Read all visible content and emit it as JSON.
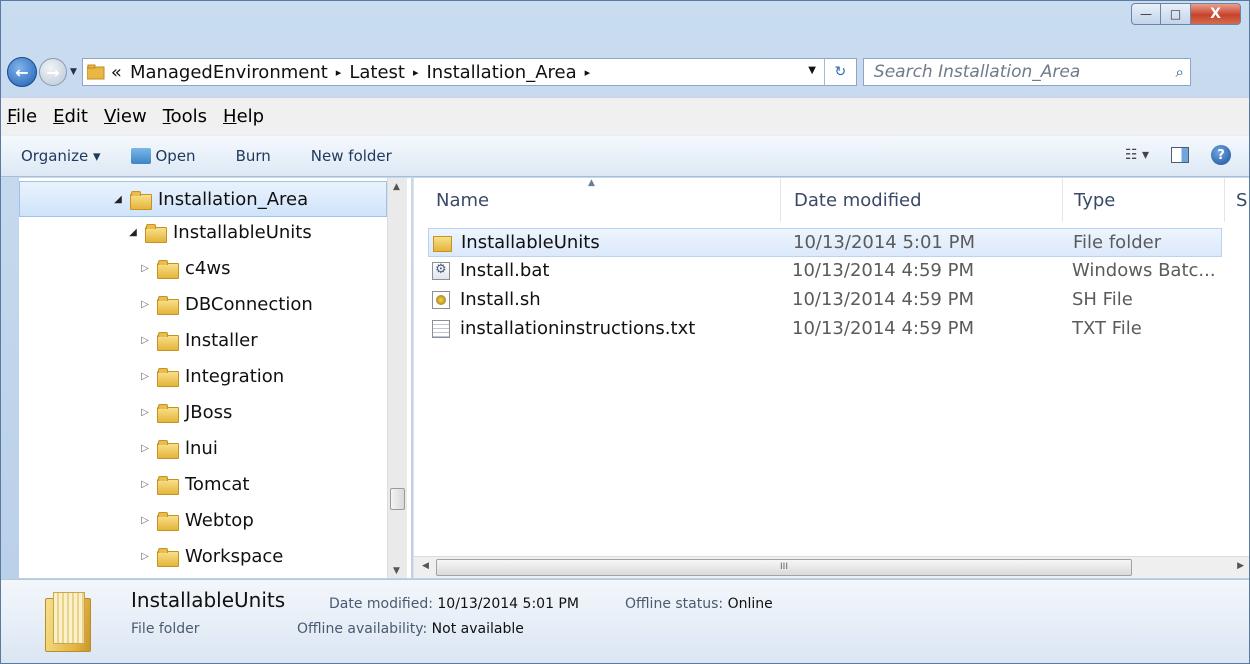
{
  "window": {
    "caption_buttons": {
      "minimize": "—",
      "maximize": "□",
      "close": "X"
    }
  },
  "navigation": {
    "back_icon": "back-arrow-icon",
    "forward_icon": "forward-arrow-icon",
    "breadcrumb": {
      "overflow": "«",
      "items": [
        "ManagedEnvironment",
        "Latest",
        "Installation_Area"
      ],
      "separator": "▸"
    },
    "search_placeholder": "Search Installation_Area"
  },
  "menu": [
    "File",
    "Edit",
    "View",
    "Tools",
    "Help"
  ],
  "commands": {
    "organize": "Organize ▾",
    "open": "Open",
    "burn": "Burn",
    "new_folder": "New folder"
  },
  "tree": [
    {
      "label": "Installation_Area",
      "state": "expanded",
      "selected": true
    },
    {
      "label": "InstallableUnits",
      "state": "expanded"
    },
    {
      "label": "c4ws",
      "state": "collapsed"
    },
    {
      "label": "DBConnection",
      "state": "collapsed"
    },
    {
      "label": "Installer",
      "state": "collapsed"
    },
    {
      "label": "Integration",
      "state": "collapsed"
    },
    {
      "label": "JBoss",
      "state": "collapsed"
    },
    {
      "label": "lnui",
      "state": "collapsed"
    },
    {
      "label": "Tomcat",
      "state": "collapsed"
    },
    {
      "label": "Webtop",
      "state": "collapsed"
    },
    {
      "label": "Workspace",
      "state": "collapsed"
    }
  ],
  "columns": {
    "name": "Name",
    "date": "Date modified",
    "type": "Type",
    "size": "S"
  },
  "files": [
    {
      "name": "InstallableUnits",
      "date": "10/13/2014 5:01 PM",
      "type": "File folder",
      "icon": "folder-icon",
      "selected": true
    },
    {
      "name": "Install.bat",
      "date": "10/13/2014 4:59 PM",
      "type": "Windows Batc...",
      "icon": "batch-file-icon"
    },
    {
      "name": "Install.sh",
      "date": "10/13/2014 4:59 PM",
      "type": "SH File",
      "icon": "sh-file-icon"
    },
    {
      "name": "installationinstructions.txt",
      "date": "10/13/2014 4:59 PM",
      "type": "TXT File",
      "icon": "text-file-icon"
    }
  ],
  "details": {
    "name": "InstallableUnits",
    "type": "File folder",
    "date_label": "Date modified:",
    "date_value": "10/13/2014 5:01 PM",
    "offline_status_label": "Offline status:",
    "offline_status_value": "Online",
    "offline_availability_label": "Offline availability:",
    "offline_availability_value": "Not available"
  },
  "scroll": {
    "hthumb_grip": "III"
  }
}
